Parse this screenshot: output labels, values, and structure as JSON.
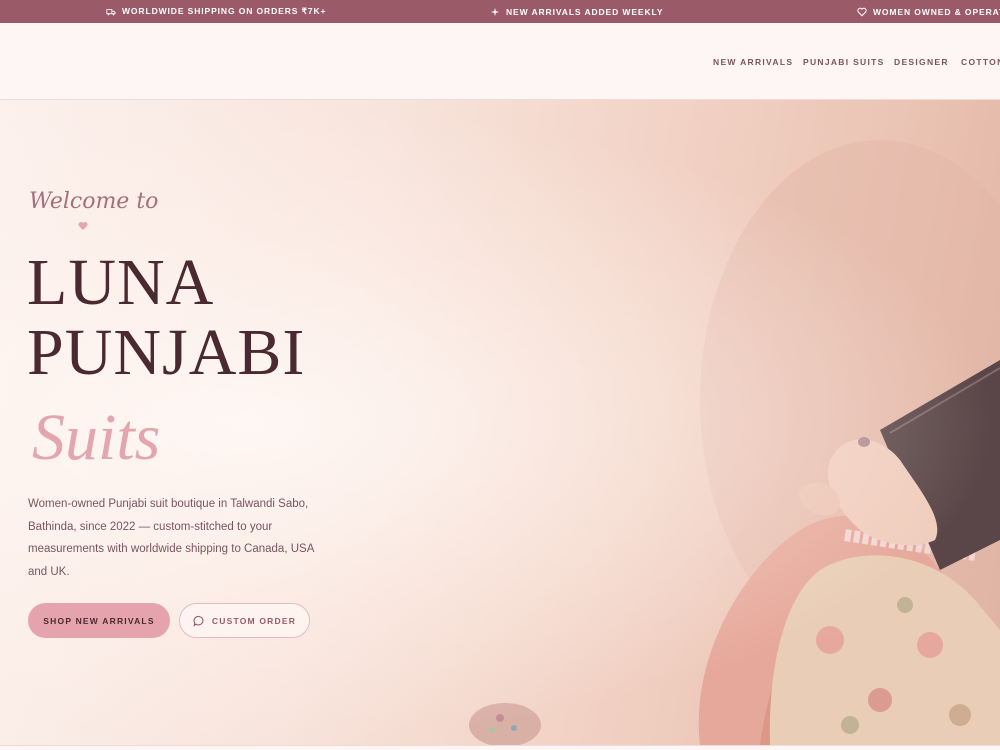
{
  "announcement": {
    "items": [
      {
        "icon": "truck-icon",
        "text": "WORLDWIDE SHIPPING ON ORDERS ₹7K+"
      },
      {
        "icon": "sparkle-icon",
        "text": "NEW ARRIVALS ADDED WEEKLY"
      },
      {
        "icon": "heart-icon",
        "text": "WOMEN OWNED & OPERATED"
      }
    ]
  },
  "nav": {
    "items": [
      "NEW ARRIVALS",
      "PUNJABI SUITS",
      "DESIGNER",
      "COTTON"
    ]
  },
  "hero": {
    "welcome": "Welcome to",
    "title_line1": "LUNA",
    "title_line2": "PUNJABI",
    "subtitle": "Suits",
    "description": "Women-owned Punjabi suit boutique in Talwandi Sabo, Bathinda, since 2022 — custom-stitched to your measurements with worldwide shipping to Canada, USA and UK.",
    "primary_cta": "SHOP NEW ARRIVALS",
    "secondary_cta": "CUSTOM ORDER"
  },
  "colors": {
    "accent": "#9b5a68",
    "pink": "#e5a4ad",
    "heading": "#4a2a30"
  }
}
